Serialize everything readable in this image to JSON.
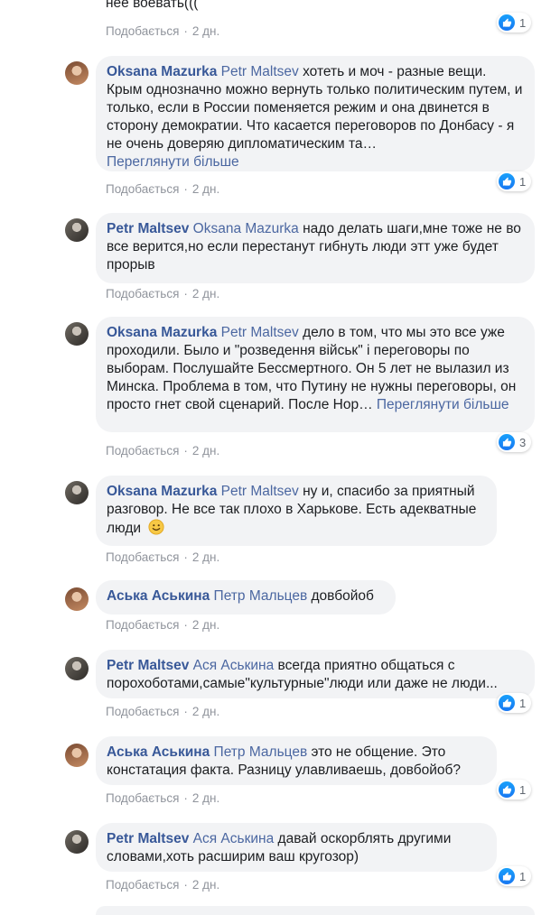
{
  "like_label": "Подобається",
  "time_label": "2 дн.",
  "top": {
    "text": "нее воевать(((",
    "reactions": "1"
  },
  "comments": [
    {
      "author": "Oksana Mazurka",
      "mention": "Petr Maltsev",
      "text": " хотеть и моч - разные вещи. Крым однозначно можно вернуть только политическим путем, и только, если в России поменяется режим и она двинется в сторону демократии. Что касается переговоров по Донбасу - я не очень доверяю дипломатическим та…",
      "more": "Переглянути більше",
      "reactions": "1"
    },
    {
      "author": "Petr Maltsev",
      "mention": "Oksana Mazurka",
      "text": " надо делать шаги,мне тоже не во все верится,но если перестанут гибнуть люди этт уже будет прорыв"
    },
    {
      "author": "Oksana Mazurka",
      "mention": "Petr Maltsev",
      "text": " дело в том, что мы это все уже проходили. Было и \"розведення військ\" і переговоры по выборам. Послушайте Бессмертного. Он 5 лет не вылазил из Минска. Проблема в том, что Путину не нужны переговоры, он просто гнет свой сценарий. После Нор…",
      "more": "Переглянути більше",
      "reactions": "3"
    },
    {
      "author": "Oksana Mazurka",
      "mention": "Petr Maltsev",
      "text": " ну и, спасибо за приятный разговор. Не все так плохо в Харькове. Есть адекватные люди"
    },
    {
      "author": "Аська Аськина",
      "mention": "Петр Мальцев",
      "text": " довбойоб"
    },
    {
      "author": "Petr Maltsev",
      "mention": "Ася Аськина",
      "text": " всегда приятно общаться с порохоботами,самые\"культурные\"люди или даже не люди...",
      "reactions": "1"
    },
    {
      "author": "Аська Аськина",
      "mention": "Петр Мальцев",
      "text": " это не общение. Это констатация факта. Разницу улавливаешь, довбойоб?",
      "reactions": "1"
    },
    {
      "author": "Petr Maltsev",
      "mention": "Ася Аськина",
      "text": " давай оскорблять другими словами,хоть расширим ваш кругозор)",
      "reactions": "1"
    }
  ]
}
